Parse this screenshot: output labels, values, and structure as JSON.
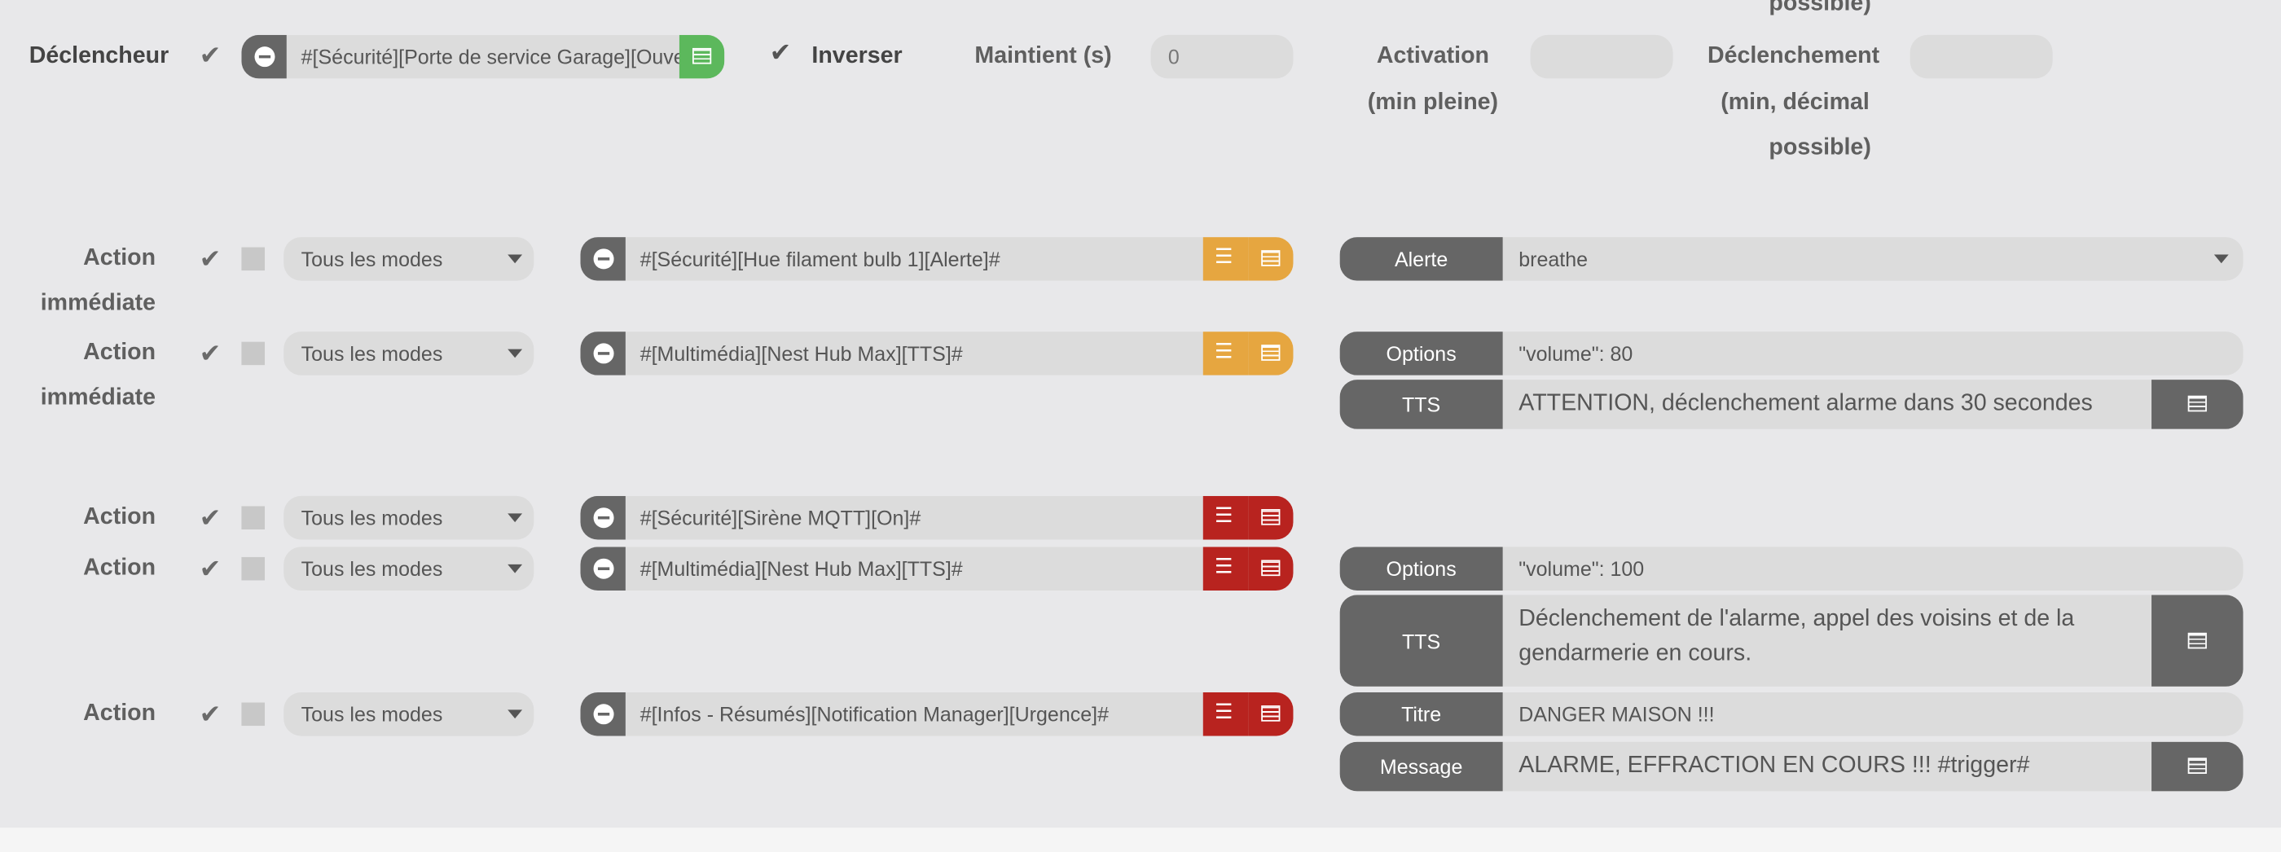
{
  "trigger": {
    "label": "Déclencheur",
    "command": "#[Sécurité][Porte de service Garage][Ouve",
    "invert_label": "Inverser",
    "hold_label": "Maintient (s)",
    "hold_value": "0",
    "activation_label_1": "Activation",
    "activation_label_2": "(min pleine)",
    "trigger_label_1": "Déclenchement",
    "trigger_label_2": "(min, décimal",
    "trigger_label_3": "possible)",
    "cut_label": "possible)"
  },
  "mode_default": "Tous les modes",
  "actions": [
    {
      "label_1": "Action",
      "label_2": "immédiate",
      "mode": "Tous les modes",
      "command": "#[Sécurité][Hue filament bulb 1][Alerte]#",
      "color": "#e6a640",
      "opt_key": "Alerte",
      "opt_value": "breathe"
    },
    {
      "label_1": "Action",
      "label_2": "immédiate",
      "mode": "Tous les modes",
      "command": "#[Multimédia][Nest Hub Max][TTS]#",
      "color": "#e6a640",
      "opt_key": "Options",
      "opt_value": "\"volume\": 80",
      "opt2_key": "TTS",
      "opt2_value": "ATTENTION, déclenchement alarme dans 30 secondes"
    },
    {
      "label_1": "Action",
      "mode": "Tous les modes",
      "command": "#[Sécurité][Sirène MQTT][On]#",
      "color": "#b8231f"
    },
    {
      "label_1": "Action",
      "mode": "Tous les modes",
      "command": "#[Multimédia][Nest Hub Max][TTS]#",
      "color": "#b8231f",
      "opt_key": "Options",
      "opt_value": "\"volume\": 100",
      "opt2_key": "TTS",
      "opt2_value": "Déclenchement de l'alarme, appel des voisins et de la gendarmerie en cours."
    },
    {
      "label_1": "Action",
      "mode": "Tous les modes",
      "command": "#[Infos - Résumés][Notification Manager][Urgence]#",
      "color": "#b8231f",
      "opt_key": "Titre",
      "opt_value": "DANGER MAISON !!!",
      "opt2_key": "Message",
      "opt2_value": "ALARME, EFFRACTION EN COURS !!! #trigger#"
    }
  ],
  "colors": {
    "panel": "#e8e8ea",
    "green": "#5cb85c",
    "orange": "#e6a640",
    "red": "#b8231f",
    "dark": "#666666"
  },
  "icons": [
    "check-icon",
    "minus-circle-icon",
    "list-icon",
    "tasks-icon",
    "caret-down-icon"
  ]
}
